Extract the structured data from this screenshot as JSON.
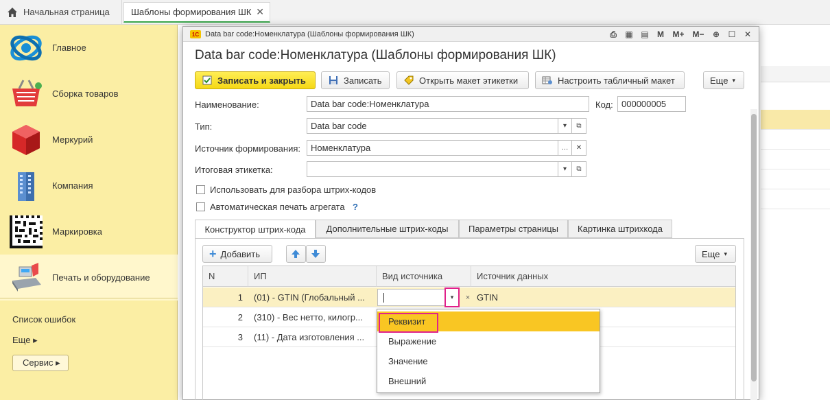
{
  "topbar": {
    "home_label": "Начальная страница",
    "doc_tab_label": "Шаблоны формирования ШК",
    "close_glyph": "✕"
  },
  "sidebar": {
    "items": [
      {
        "label": "Главное",
        "icon": "main-globe-icon"
      },
      {
        "label": "Сборка товаров",
        "icon": "basket-icon"
      },
      {
        "label": "Меркурий",
        "icon": "red-cube-icon"
      },
      {
        "label": "Компания",
        "icon": "building-icon"
      },
      {
        "label": "Маркировка",
        "icon": "datamatrix-icon"
      },
      {
        "label": "Печать и оборудование",
        "icon": "cash-register-icon"
      }
    ],
    "active_index": 5,
    "links": [
      "Список ошибок",
      "Еще ▸"
    ],
    "service_label": "Сервис ▸"
  },
  "modal": {
    "window_title": "Data bar code:Номенклатура (Шаблоны формирования ШК)",
    "form_title": "Data bar code:Номенклатура (Шаблоны формирования ШК)",
    "toolbar": {
      "save_close": "Записать и закрыть",
      "save": "Записать",
      "open_layout": "Открыть макет этикетки",
      "setup_layout": "Настроить табличный макет",
      "more": "Еще"
    },
    "fields": {
      "name_label": "Наименование:",
      "name_value": "Data bar code:Номенклатура",
      "code_label": "Код:",
      "code_value": "000000005",
      "type_label": "Тип:",
      "type_value": "Data bar code",
      "source_label": "Источник формирования:",
      "source_value": "Номенклатура",
      "final_label_label": "Итоговая этикетка:",
      "final_label_value": ""
    },
    "checkboxes": {
      "use_for_parsing": "Использовать для разбора штрих-кодов",
      "auto_print": "Автоматическая печать агрегата",
      "help_glyph": "?"
    },
    "tabs": [
      "Конструктор штрих-кода",
      "Дополнительные штрих-коды",
      "Параметры страницы",
      "Картинка штрихкода"
    ],
    "grid_toolbar": {
      "add": "Добавить",
      "more": "Еще"
    },
    "grid": {
      "columns": [
        "N",
        "ИП",
        "Вид источника",
        "Источник данных"
      ],
      "rows": [
        {
          "n": "1",
          "ip": "(01) - GTIN (Глобальный ...",
          "kind": "",
          "source": "GTIN"
        },
        {
          "n": "2",
          "ip": "(310) - Вес нетто, килогр...",
          "kind": "",
          "source": ""
        },
        {
          "n": "3",
          "ip": "(11) - Дата изготовления ...",
          "kind": "",
          "source": ""
        }
      ]
    },
    "dropdown": {
      "options": [
        "Реквизит",
        "Выражение",
        "Значение",
        "Внешний"
      ],
      "highlighted_index": 0
    }
  },
  "colors": {
    "sidebar_bg": "#fbeea4",
    "primary_button": "#f5d815",
    "highlight_border": "#e0218a",
    "selected_row": "#fbf0c2",
    "dropdown_highlight": "#f9c623",
    "active_tab_underline": "#3aa64c"
  }
}
